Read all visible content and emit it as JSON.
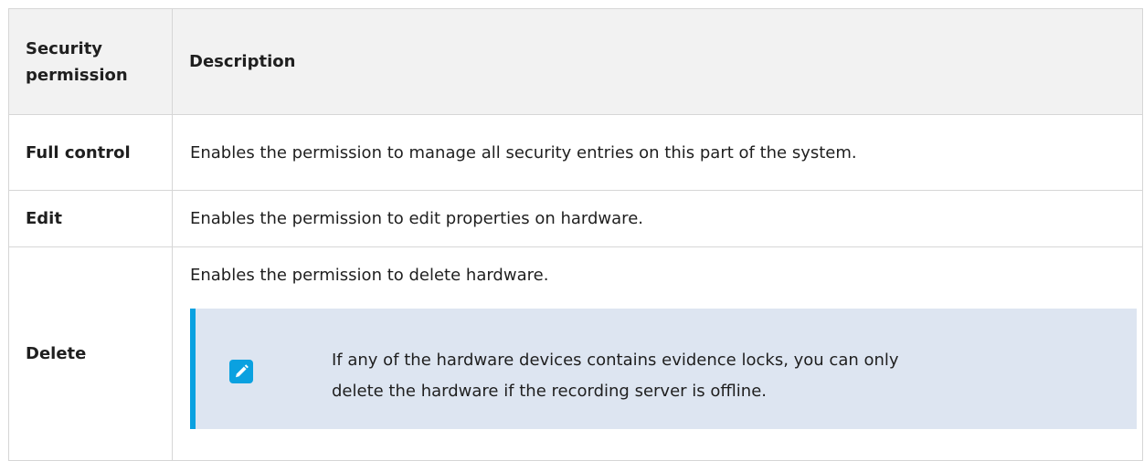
{
  "table": {
    "headers": {
      "permission": "Security permission",
      "description": "Description"
    },
    "rows": [
      {
        "permission": "Full control",
        "description": "Enables the permission to manage all security entries on this part of the system."
      },
      {
        "permission": "Edit",
        "description": "Enables the permission to edit properties on hardware."
      },
      {
        "permission": "Delete",
        "description": "Enables the permission to delete hardware.",
        "note": {
          "icon": "pencil-icon",
          "line1": "If any of the hardware devices contains evidence locks, you can only",
          "line2": "delete the hardware if the recording server is offline."
        }
      }
    ]
  },
  "colors": {
    "header_bg": "#f2f2f2",
    "border": "#d6d6d6",
    "note_bg": "#dde5f1",
    "note_accent": "#0aa1e0"
  }
}
